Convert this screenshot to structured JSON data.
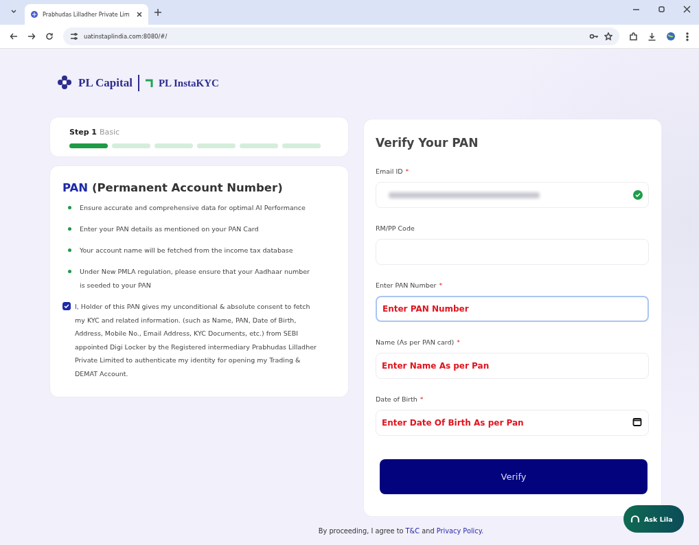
{
  "browser": {
    "tab_title": "Prabhudas Lilladher Private Lim",
    "url": "uatinstaplindia.com:8080/#/"
  },
  "logo": {
    "brand": "PL Capital",
    "product": "PL InstaKYC"
  },
  "stepper": {
    "step": "Step 1",
    "name": "Basic",
    "segments": [
      {
        "complete": true
      },
      {
        "complete": false
      },
      {
        "complete": false
      },
      {
        "complete": false
      },
      {
        "complete": false
      },
      {
        "complete": false
      }
    ]
  },
  "info": {
    "title_highlight": "PAN",
    "title_rest": "(Permanent Account Number)",
    "bullets": [
      "Ensure accurate and comprehensive data for optimal AI Performance",
      "Enter your PAN details as mentioned on your PAN Card",
      "Your account name will be fetched from the income tax database",
      "Under New PMLA regulation, please ensure that your Aadhaar number is seeded to your PAN"
    ],
    "consent": {
      "checked": true,
      "text": "I, Holder of this PAN gives my unconditional & absolute consent to fetch my KYC and related information. (such as Name, PAN, Date of Birth, Address, Mobile No., Email Address, KYC Documents, etc.) from SEBI appointed Digi Locker by the Registered intermediary Prabhudas Lilladher Private Limited to authenticate my identity for opening my Trading & DEMAT Account."
    }
  },
  "form": {
    "title": "Verify Your PAN",
    "fields": [
      {
        "label": "Email ID",
        "required_mark": "*",
        "kind": "redacted",
        "valid": true,
        "focused": false
      },
      {
        "label": "RM/PP Code",
        "kind": "text",
        "focused": false
      },
      {
        "label": "Enter PAN Number",
        "required_mark": "*",
        "kind": "text",
        "placeholder": "Enter PAN Number",
        "focused": true
      },
      {
        "label": "Name (As per PAN card)",
        "required_mark": "*",
        "kind": "text",
        "placeholder": "Enter Name As per Pan",
        "focused": false
      },
      {
        "label": "Date of Birth",
        "required_mark": "*",
        "kind": "date",
        "placeholder": "Enter Date Of Birth As per Pan",
        "focused": false
      }
    ],
    "button": "Verify"
  },
  "footer": {
    "before": "By proceeding, I agree to",
    "link1": "T&C",
    "middle": "and",
    "link2": "Privacy Policy."
  },
  "chat_button": "Ask Lila"
}
